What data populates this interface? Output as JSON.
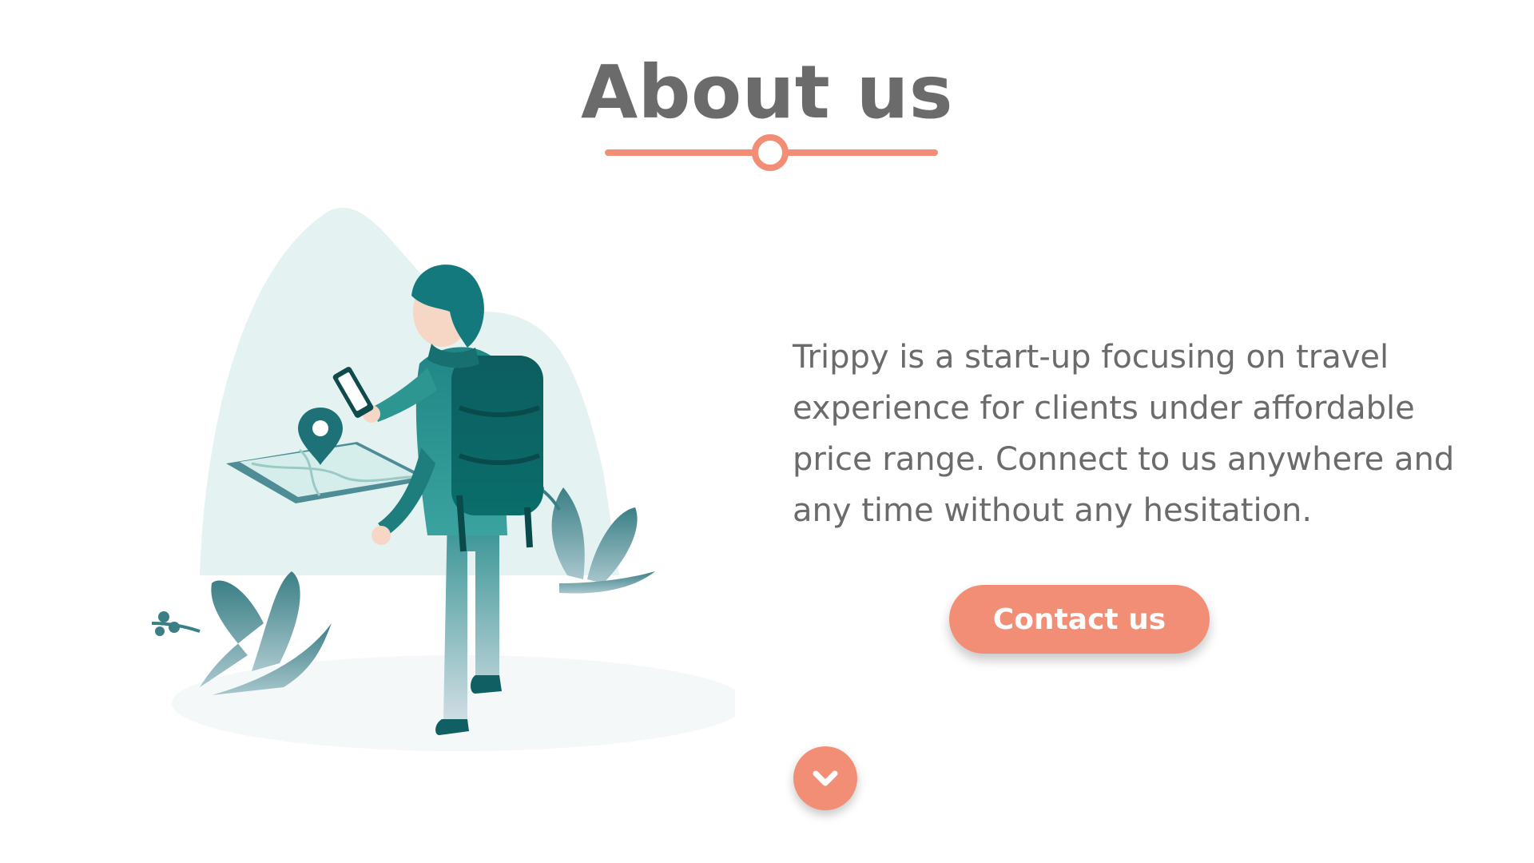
{
  "about": {
    "title": "About us",
    "description": "Trippy is a start-up focusing on travel\nexperience for clients under affordable\nprice range. Connect to us anywhere and\nany time without any hesitation.",
    "contact_button_label": "Contact us"
  },
  "scroll": {
    "icon": "chevron-down-icon"
  },
  "illustration": {
    "subject": "traveler-with-backpack-and-map"
  },
  "colors": {
    "accent": "#f28e75",
    "text": "#6b6b6b",
    "teal_dark": "#0f5f63",
    "teal": "#2e8f8f",
    "teal_light": "#dff1ef",
    "background": "#ffffff"
  }
}
